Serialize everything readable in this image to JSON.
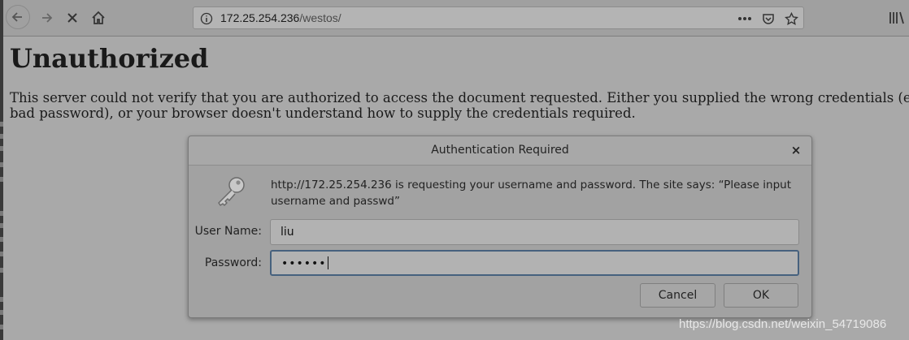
{
  "browser": {
    "url_host": "172.25.254.236",
    "url_path": "/westos/",
    "icons": [
      "back-icon",
      "forward-icon",
      "stop-icon",
      "home-icon",
      "info-icon",
      "more-icon",
      "pocket-icon",
      "bookmark-star-icon",
      "library-icon"
    ]
  },
  "page": {
    "heading": "Unauthorized",
    "body": "This server could not verify that you are authorized to access the document requested. Either you supplied the wrong credentials (e.g., bad password), or your browser doesn't understand how to supply the credentials required."
  },
  "dialog": {
    "title": "Authentication Required",
    "close_label": "×",
    "message": "http://172.25.254.236 is requesting your username and password. The site says: “Please input username and passwd”",
    "username_label": "User Name:",
    "username_value": "liu",
    "password_label": "Password:",
    "password_value": "••••••",
    "cancel_label": "Cancel",
    "ok_label": "OK"
  },
  "watermark": "https://blog.csdn.net/weixin_54719086"
}
